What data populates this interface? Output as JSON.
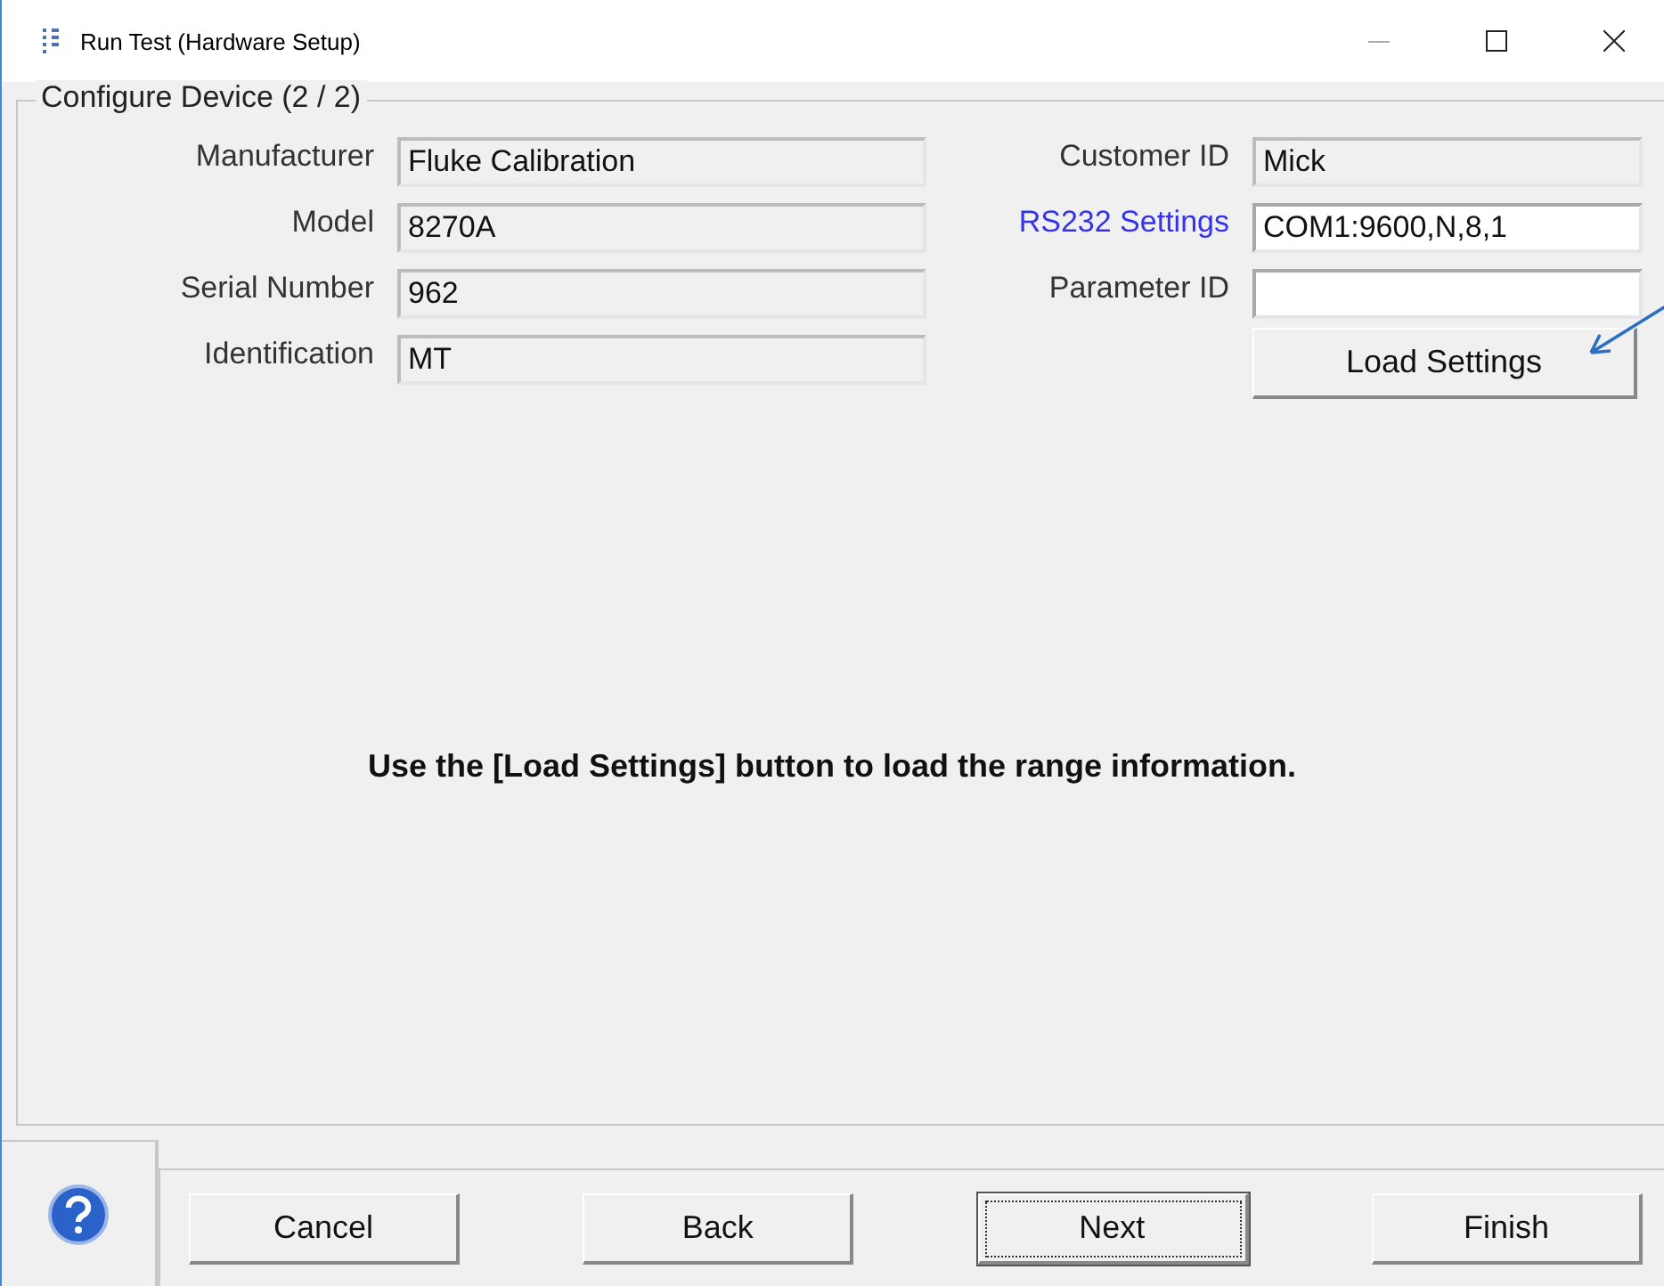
{
  "window": {
    "title": "Run Test (Hardware Setup)"
  },
  "group": {
    "title": "Configure Device (2 / 2)"
  },
  "left_fields": [
    {
      "label": "Manufacturer",
      "value": "Fluke Calibration",
      "readonly": true,
      "link": false
    },
    {
      "label": "Model",
      "value": "8270A",
      "readonly": true,
      "link": false
    },
    {
      "label": "Serial Number",
      "value": "962",
      "readonly": true,
      "link": false
    },
    {
      "label": "Identification",
      "value": "MT",
      "readonly": true,
      "link": false
    }
  ],
  "right_fields": [
    {
      "label": "Customer ID",
      "value": "Mick",
      "readonly": true,
      "link": false
    },
    {
      "label": "RS232 Settings",
      "value": "COM1:9600,N,8,1",
      "readonly": false,
      "link": true
    },
    {
      "label": "Parameter ID",
      "readonly": false,
      "link": false
    }
  ],
  "load_button": {
    "label": "Load Settings"
  },
  "message": "Use the [Load Settings] button to load the range information.",
  "buttons": [
    {
      "label": "Cancel",
      "default": false
    },
    {
      "label": "Back",
      "default": false
    },
    {
      "label": "Next",
      "default": true
    },
    {
      "label": "Finish",
      "default": false
    }
  ]
}
